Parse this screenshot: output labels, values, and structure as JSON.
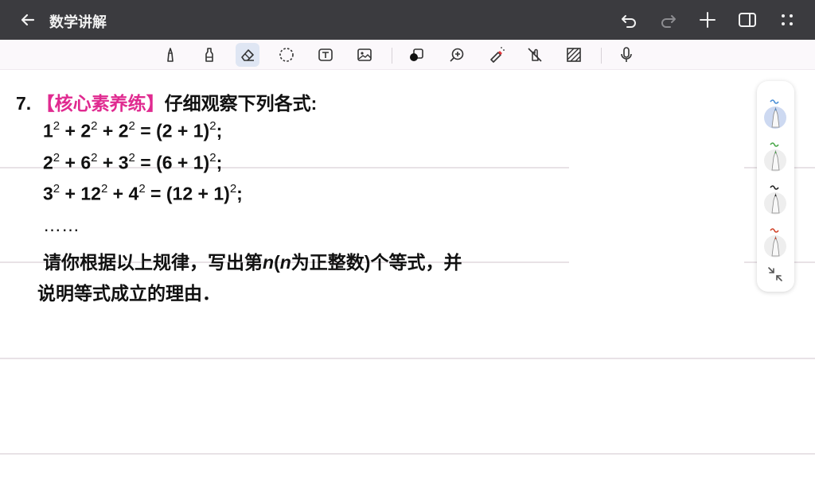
{
  "header": {
    "title": "数学讲解",
    "icons": [
      "back-arrow-icon",
      "undo-icon",
      "redo-icon",
      "add-icon",
      "panel-toggle-icon",
      "more-icon"
    ]
  },
  "toolbar": {
    "tools": [
      "pen",
      "highlighter",
      "eraser",
      "lasso",
      "text",
      "image",
      "shape",
      "zoom",
      "laser",
      "hand-draw-toggle",
      "background-pattern",
      "microphone"
    ],
    "active_tool": "eraser"
  },
  "problem": {
    "number": "7.",
    "tag": "【核心素养练】",
    "intro": "仔细观察下列各式:",
    "eq1": {
      "a": "1",
      "b": "2",
      "c": "2",
      "rhs_inner": "2",
      "one": "1"
    },
    "eq2": {
      "a": "2",
      "b": "6",
      "c": "3",
      "rhs_inner": "6",
      "one": "1"
    },
    "eq3": {
      "a": "3",
      "b": "12",
      "c": "4",
      "rhs_inner": "12",
      "one": "1"
    },
    "exp": "2",
    "ellipsis": "……",
    "q_part1": "请你根据以上规律，写出第",
    "n": "n",
    "q_part2": "为正整数)个等式，并",
    "q_line2": "说明等式成立的理由．"
  },
  "pen_panel": {
    "pens": [
      {
        "name": "pen-blue",
        "color": "#4a8fd6",
        "selected": true
      },
      {
        "name": "pen-green",
        "color": "#4aa84a",
        "selected": false
      },
      {
        "name": "pen-black",
        "color": "#222222",
        "selected": false
      },
      {
        "name": "pen-red",
        "color": "#d2452b",
        "selected": false
      }
    ]
  },
  "colors": {
    "titlebar": "#3b3b3f",
    "tag": "#e02a90",
    "active_tool_bg": "#dfe6f3"
  }
}
